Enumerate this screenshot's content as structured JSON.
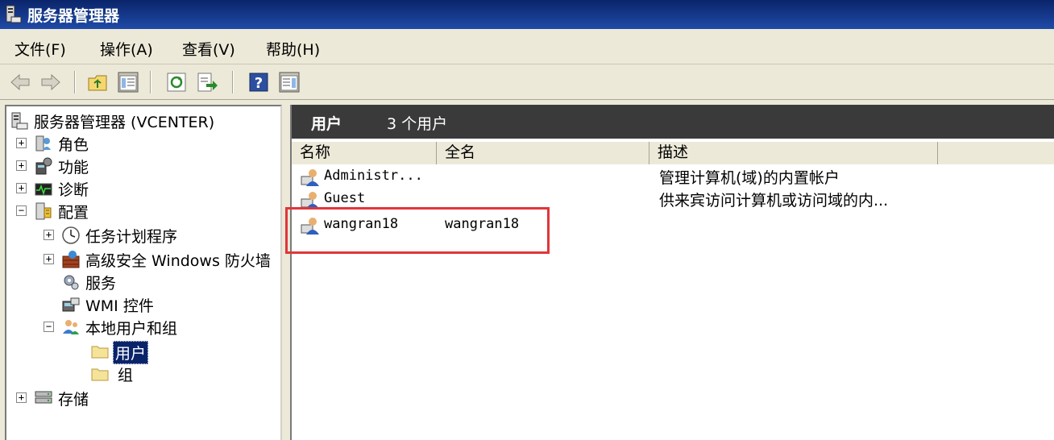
{
  "window": {
    "title": "服务器管理器",
    "app_icon": "server-manager-icon"
  },
  "menu": {
    "items": [
      {
        "label": "文件(F)"
      },
      {
        "label": "操作(A)"
      },
      {
        "label": "查看(V)"
      },
      {
        "label": "帮助(H)"
      }
    ]
  },
  "toolbar": {
    "buttons": [
      {
        "icon": "back-arrow-icon"
      },
      {
        "icon": "forward-arrow-icon"
      },
      {
        "icon": "up-folder-icon"
      },
      {
        "icon": "show-hide-tree-icon"
      },
      {
        "icon": "refresh-icon"
      },
      {
        "icon": "export-list-icon"
      },
      {
        "icon": "help-icon"
      },
      {
        "icon": "show-hide-action-pane-icon"
      }
    ]
  },
  "tree": {
    "root": {
      "label": "服务器管理器 (VCENTER)",
      "icon": "server-manager-icon"
    },
    "items": [
      {
        "label": "角色",
        "icon": "roles-icon",
        "expander": "+"
      },
      {
        "label": "功能",
        "icon": "features-icon",
        "expander": "+"
      },
      {
        "label": "诊断",
        "icon": "diagnostics-icon",
        "expander": "+"
      },
      {
        "label": "配置",
        "icon": "configuration-icon",
        "expander": "−"
      },
      {
        "label": "任务计划程序",
        "icon": "clock-icon",
        "expander": "+"
      },
      {
        "label": "高级安全 Windows 防火墙",
        "icon": "firewall-icon",
        "expander": "+"
      },
      {
        "label": "服务",
        "icon": "services-gear-icon",
        "expander": ""
      },
      {
        "label": "WMI 控件",
        "icon": "wmi-icon",
        "expander": ""
      },
      {
        "label": "本地用户和组",
        "icon": "users-groups-icon",
        "expander": "−"
      },
      {
        "label": "用户",
        "icon": "folder-icon",
        "expander": ""
      },
      {
        "label": "组",
        "icon": "folder-icon",
        "expander": ""
      },
      {
        "label": "存储",
        "icon": "storage-icon",
        "expander": "+"
      }
    ]
  },
  "content": {
    "header_title": "用户",
    "header_count": "3 个用户",
    "columns": [
      "名称",
      "全名",
      "描述"
    ],
    "rows": [
      {
        "name": "Administr...",
        "fullname": "",
        "description": "管理计算机(域)的内置帐户"
      },
      {
        "name": "Guest",
        "fullname": "",
        "description": "供来宾访问计算机或访问域的内..."
      },
      {
        "name": "wangran18",
        "fullname": "wangran18",
        "description": ""
      }
    ]
  },
  "colors": {
    "title_bar": "#0a246a",
    "content_header": "#3a3a3a",
    "selection": "#0a246a",
    "highlight_box": "#e0363a"
  }
}
